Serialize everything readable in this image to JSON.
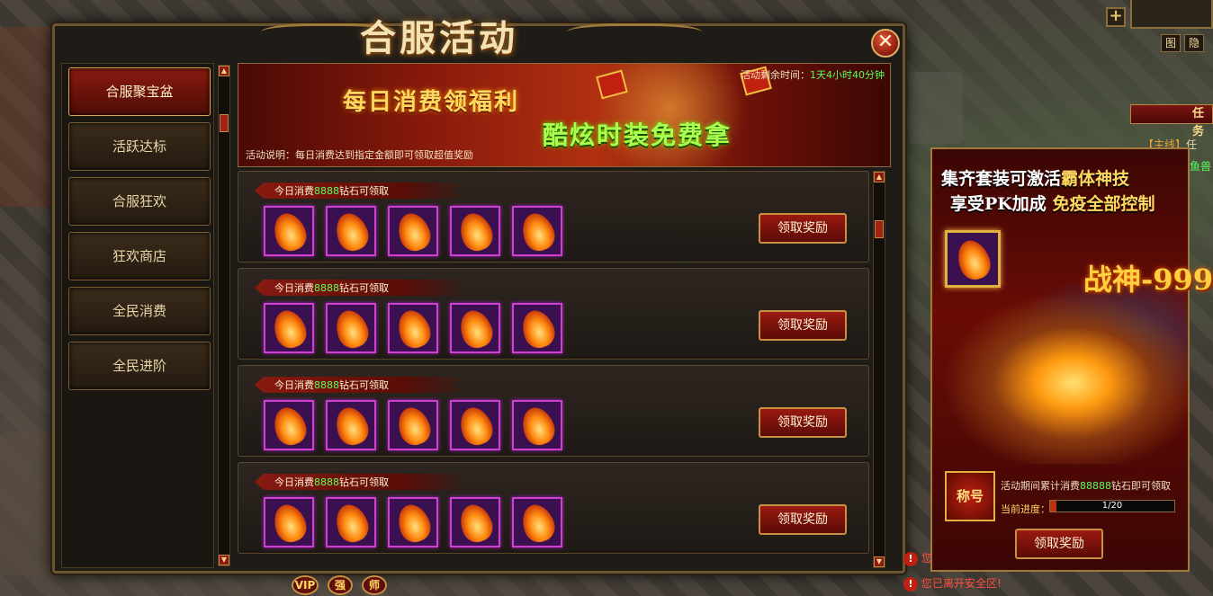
{
  "window": {
    "title": "合服活动"
  },
  "nav": {
    "items": [
      {
        "label": "合服聚宝盆",
        "active": true
      },
      {
        "label": "活跃达标",
        "active": false
      },
      {
        "label": "合服狂欢",
        "active": false
      },
      {
        "label": "狂欢商店",
        "active": false
      },
      {
        "label": "全民消费",
        "active": false
      },
      {
        "label": "全民进阶",
        "active": false
      }
    ]
  },
  "banner": {
    "title1": "每日消费领福利",
    "title2": "酷炫时装免费拿",
    "timer_label": "活动剩余时间：",
    "timer_value": "1天4小时40分钟",
    "description": "活动说明：每日消费达到指定金额即可领取超值奖励"
  },
  "rewards": [
    {
      "prefix": "今日消费",
      "amount": "8888",
      "suffix": "钻石可领取",
      "item_count": 5,
      "button": "领取奖励"
    },
    {
      "prefix": "今日消费",
      "amount": "8888",
      "suffix": "钻石可领取",
      "item_count": 5,
      "button": "领取奖励"
    },
    {
      "prefix": "今日消费",
      "amount": "8888",
      "suffix": "钻石可领取",
      "item_count": 5,
      "button": "领取奖励"
    },
    {
      "prefix": "今日消费",
      "amount": "8888",
      "suffix": "钻石可领取",
      "item_count": 5,
      "button": "领取奖励"
    }
  ],
  "promo": {
    "line1_a": "集齐套装可激活",
    "line1_b": "霸体神技",
    "line2_a": "享受PK加成",
    "line2_b": "免疫全部控制",
    "hero_text": "战神-999",
    "badge": "称号",
    "desc_prefix": "活动期间累计消费",
    "desc_amount": "88888",
    "desc_suffix": "钻石即可领取",
    "progress_label": "当前进度：",
    "progress_text": "1/20",
    "progress_fraction": 0.05,
    "button": "领取奖励"
  },
  "hud": {
    "plus": "+",
    "map_btn": "图",
    "hide_btn": "隐",
    "task_title": "任务",
    "task_lines": [
      {
        "tag": "【主线】",
        "text": "任"
      },
      {
        "tag": "",
        "text": "鱼兽"
      }
    ],
    "bottom_buttons": [
      "VIP",
      "强",
      "师"
    ],
    "warnings": [
      "您",
      "您已离开安全区!"
    ]
  },
  "colors": {
    "accent": "#8a1a10",
    "gold": "#c89040",
    "highlight_green": "#5aff5a"
  }
}
